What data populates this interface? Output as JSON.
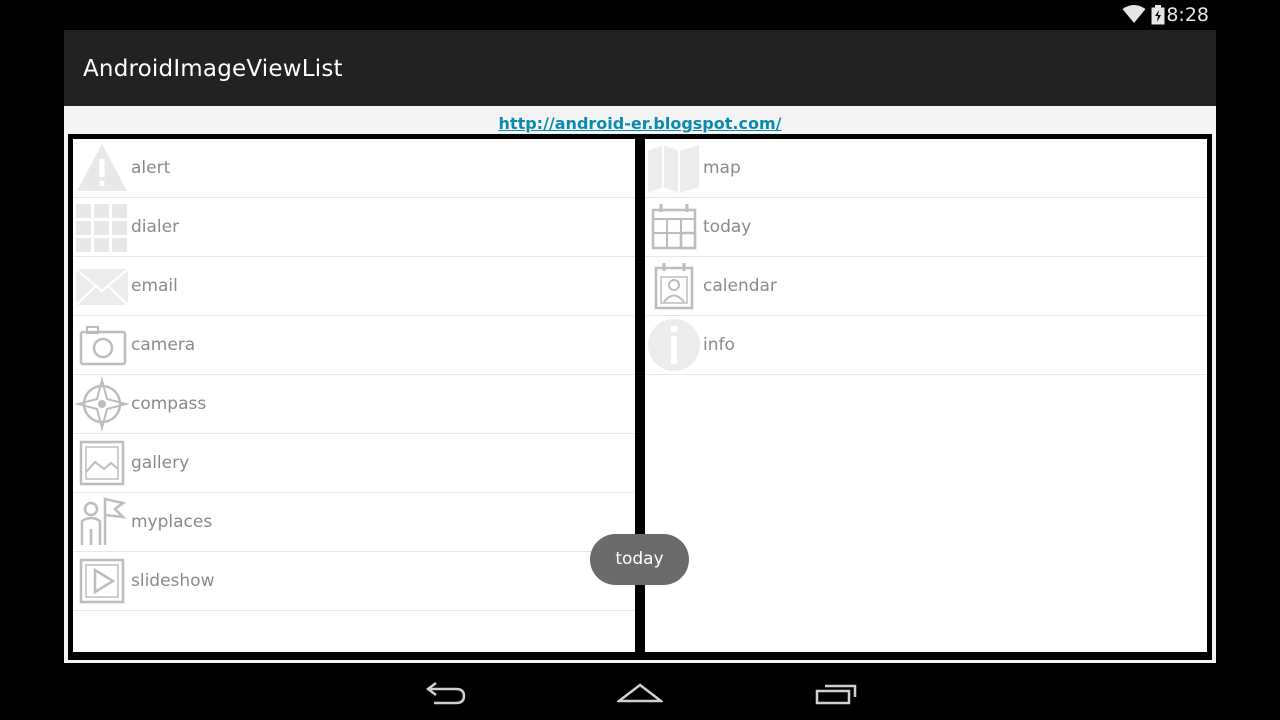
{
  "status_bar": {
    "time": "8:28",
    "icons": [
      "wifi-icon",
      "battery-icon"
    ]
  },
  "app_bar": {
    "title": "AndroidImageViewList"
  },
  "link": {
    "text": "http://android-er.blogspot.com/"
  },
  "left_list": {
    "items": [
      {
        "label": "alert",
        "icon": "alert-icon"
      },
      {
        "label": "dialer",
        "icon": "dialer-icon"
      },
      {
        "label": "email",
        "icon": "email-icon"
      },
      {
        "label": "camera",
        "icon": "camera-icon"
      },
      {
        "label": "compass",
        "icon": "compass-icon"
      },
      {
        "label": "gallery",
        "icon": "gallery-icon"
      },
      {
        "label": "myplaces",
        "icon": "myplaces-icon"
      },
      {
        "label": "slideshow",
        "icon": "slideshow-icon"
      }
    ]
  },
  "right_list": {
    "items": [
      {
        "label": "map",
        "icon": "map-icon"
      },
      {
        "label": "today",
        "icon": "today-icon"
      },
      {
        "label": "calendar",
        "icon": "calendar-icon"
      },
      {
        "label": "info",
        "icon": "info-icon"
      }
    ]
  },
  "toast": {
    "text": "today"
  },
  "nav_bar": {
    "buttons": [
      "back-icon",
      "home-icon",
      "recents-icon"
    ]
  },
  "colors": {
    "app_bar": "#222222",
    "link": "#0a8bae",
    "item_text": "#8a8a8a",
    "toast": "#6b6b6b",
    "icon_gray": "#bdbdbd"
  }
}
